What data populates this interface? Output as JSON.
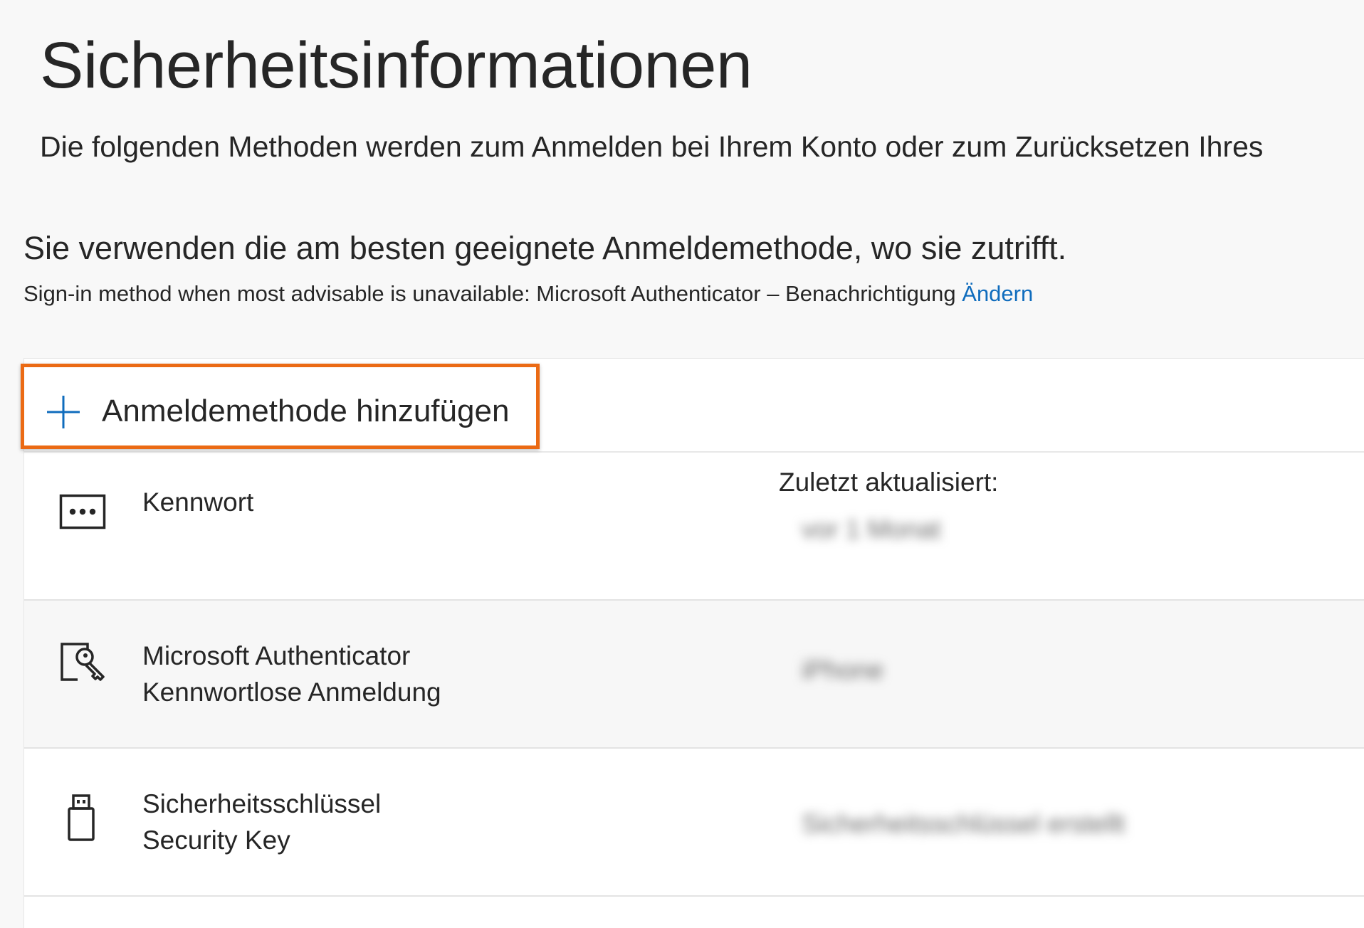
{
  "page": {
    "title": "Sicherheitsinformationen",
    "description": "Die folgenden Methoden werden zum Anmelden bei Ihrem Konto oder zum Zurücksetzen Ihres"
  },
  "default_method": {
    "heading": "Sie verwenden die am besten geeignete Anmeldemethode, wo sie zutrifft.",
    "fallback_text": "Sign-in method when most advisable is unavailable: Microsoft Authenticator – Benachrichtigung",
    "change_link": "Ändern"
  },
  "add_method": {
    "label": "Anmeldemethode hinzufügen",
    "icon": "plus-icon",
    "highlight_color": "#eb6a14"
  },
  "methods": [
    {
      "icon": "password-icon",
      "line1": "Kennwort",
      "line2": "",
      "info_label": "Zuletzt aktualisiert:",
      "info_value": "vor 1 Monat"
    },
    {
      "icon": "authenticator-icon",
      "line1": "Microsoft Authenticator",
      "line2": "Kennwortlose Anmeldung",
      "info_label": "",
      "info_value": "iPhone"
    },
    {
      "icon": "security-key-icon",
      "line1": "Sicherheitsschlüssel",
      "line2": "Security Key",
      "info_label": "",
      "info_value": "Sicherheitsschlüssel erstellt"
    }
  ],
  "colors": {
    "background": "#f8f8f8",
    "panel": "#ffffff",
    "link": "#0f6cbd",
    "accent_plus": "#0f6cbd"
  }
}
